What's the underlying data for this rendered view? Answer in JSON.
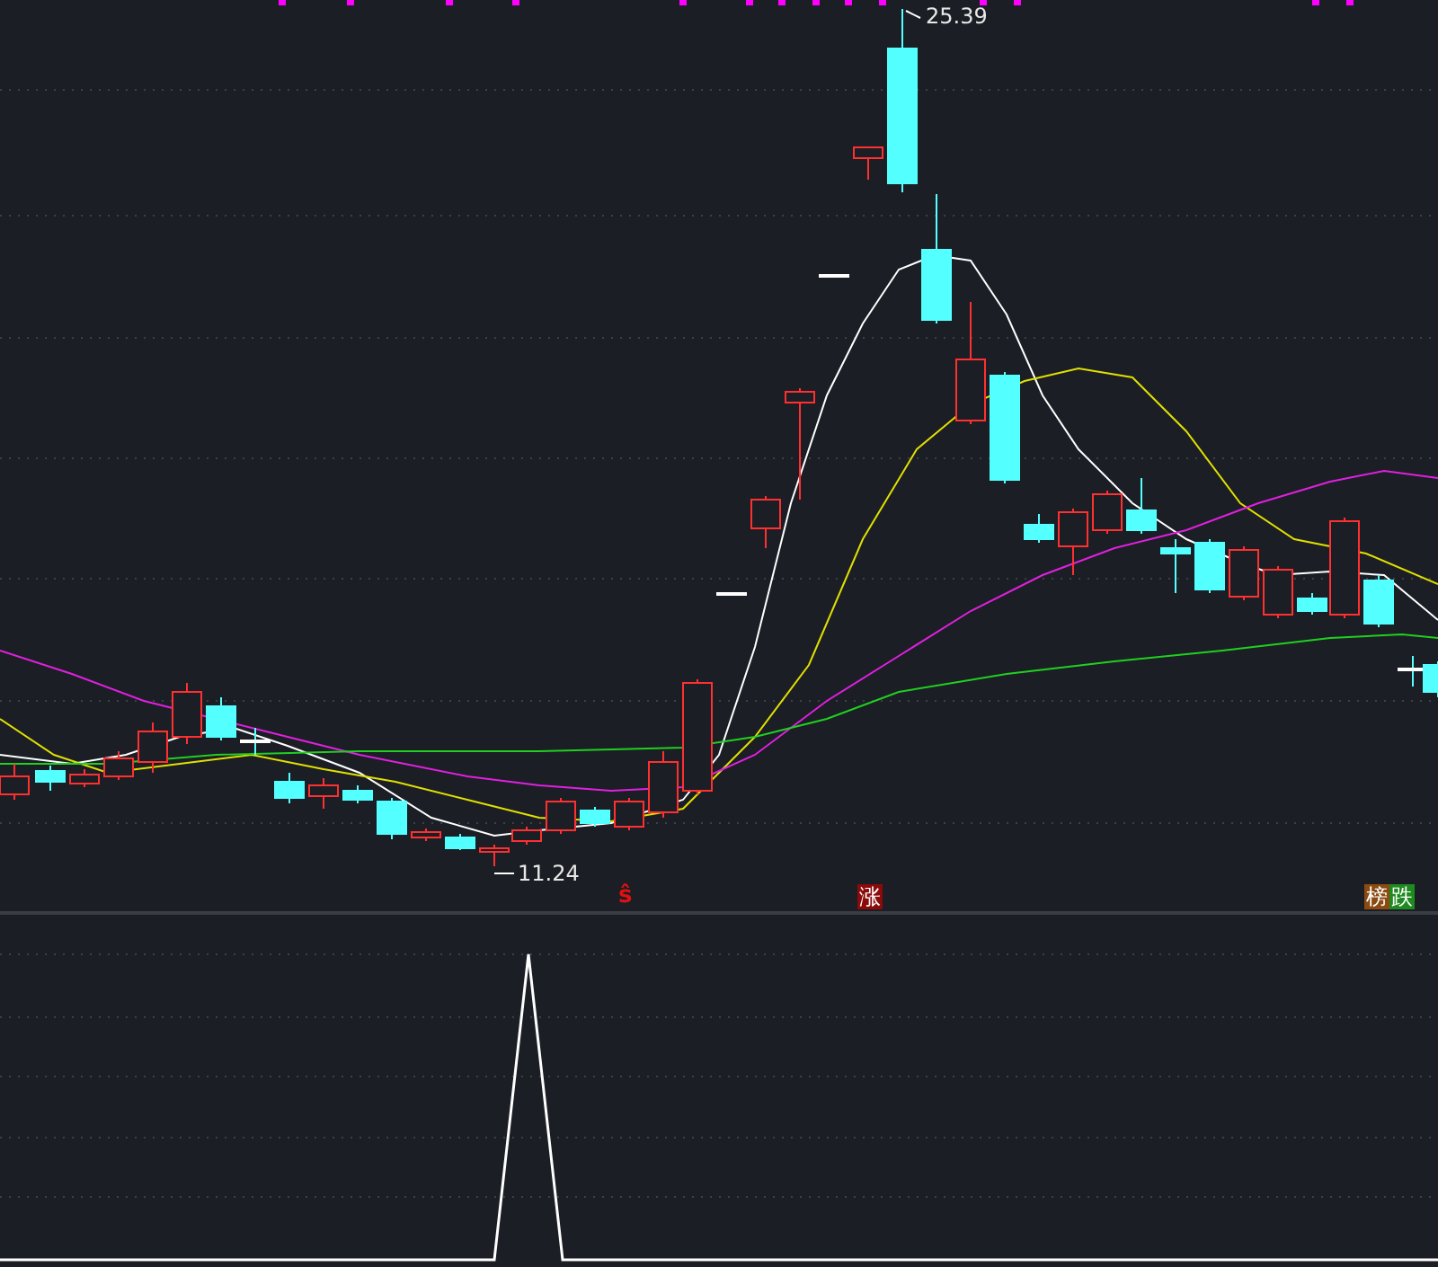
{
  "price_chart": {
    "high_label": "25.39",
    "low_label": "11.24"
  },
  "signals": [
    {
      "kind": "glyph",
      "label": "ŝ",
      "color": "#e01010"
    },
    {
      "kind": "badge",
      "label": "涨",
      "color": "#8b0a0a"
    },
    {
      "kind": "badge",
      "label": "榜",
      "color": "#8a4a10"
    },
    {
      "kind": "badge",
      "label": "跌",
      "color": "#1f8a1f"
    }
  ]
}
